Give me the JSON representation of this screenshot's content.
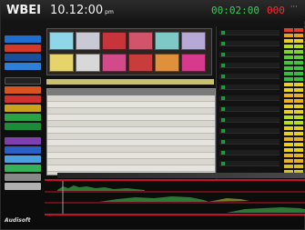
{
  "header": {
    "station": "WBEI",
    "clock": "10.12:00",
    "clock_suffix": "pm",
    "timer_elapsed": "00:02:00",
    "timer_remaining": "000",
    "menu": "···"
  },
  "colors": {
    "accent_red": "#c8102e",
    "green": "#27d84b",
    "timer_red": "#ff2a2a"
  },
  "logo": "Audisoft"
}
